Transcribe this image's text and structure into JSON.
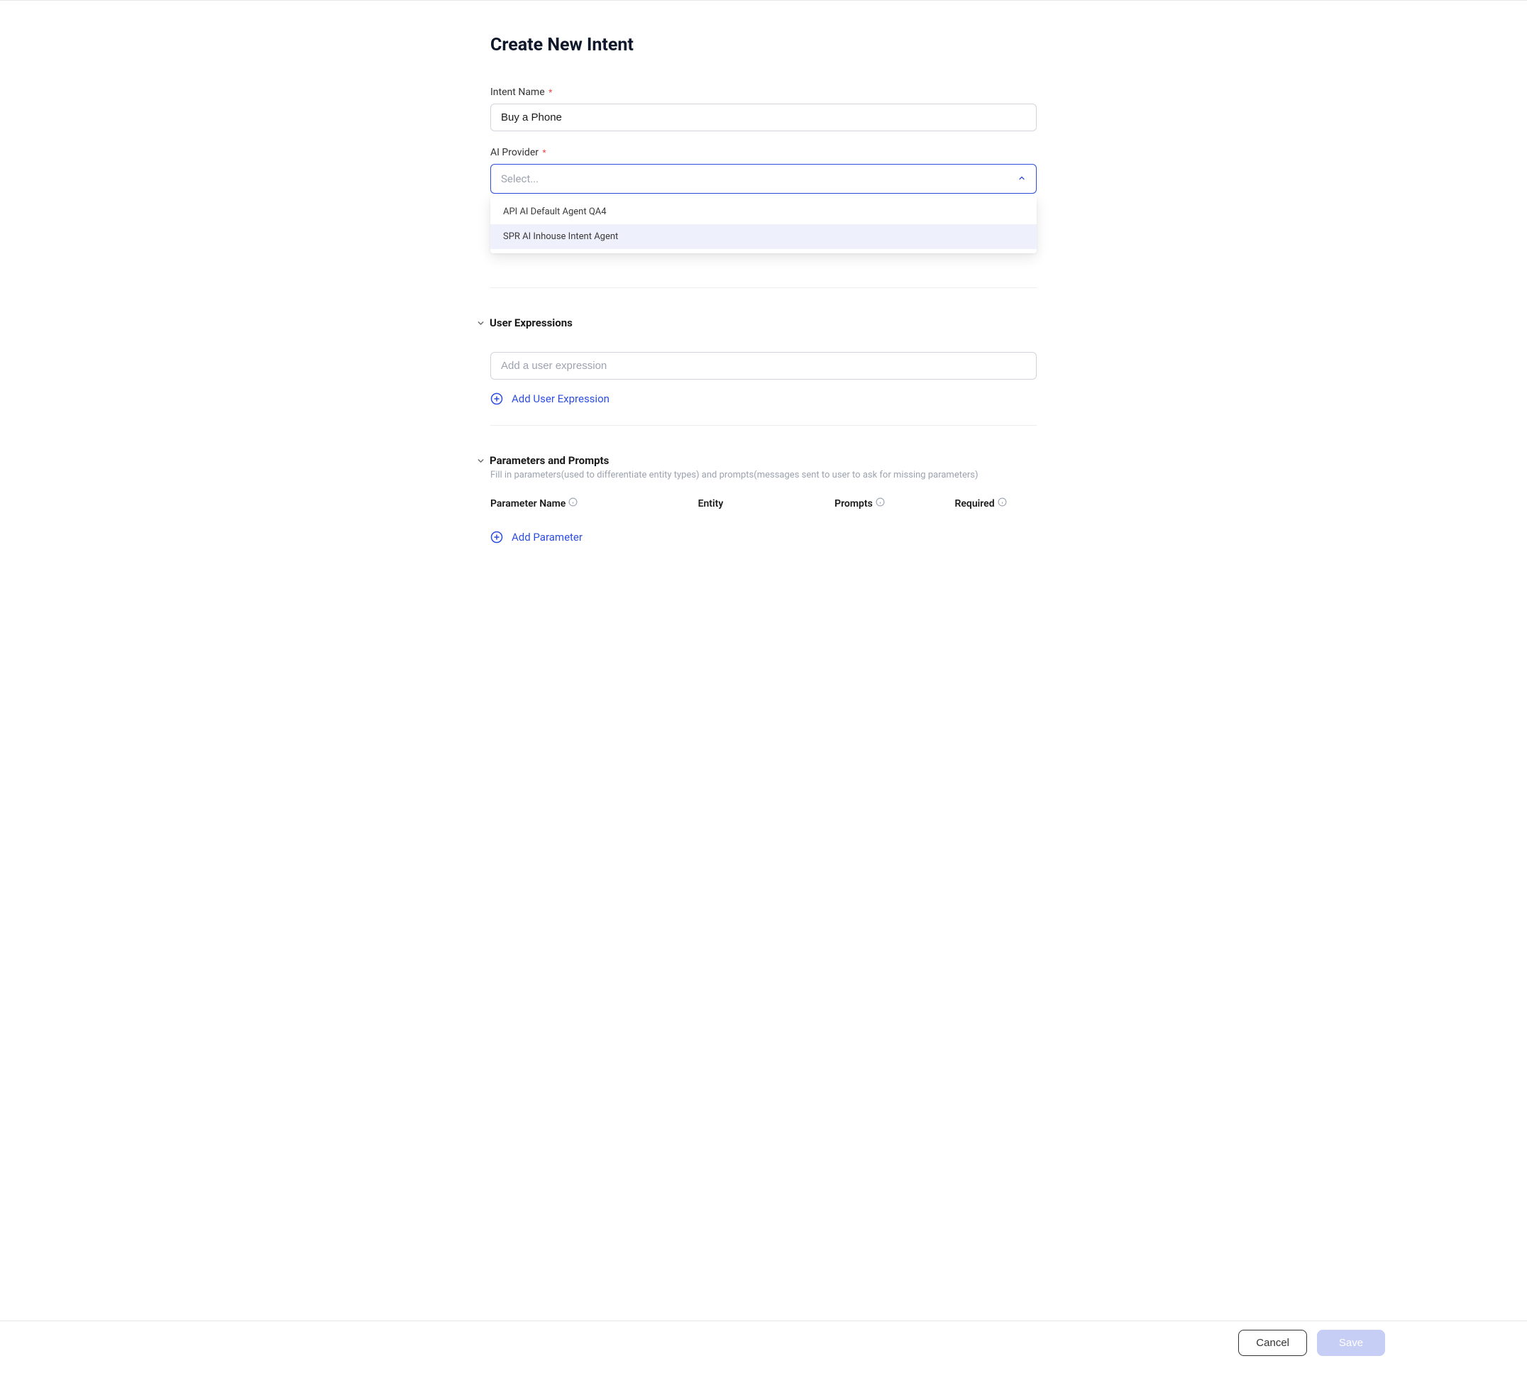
{
  "header": {
    "title": "Create New Intent"
  },
  "form": {
    "intentName": {
      "label": "Intent Name",
      "value": "Buy a Phone"
    },
    "aiProvider": {
      "label": "AI Provider",
      "placeholder": "Select...",
      "options": [
        "API AI Default Agent QA4",
        "SPR AI Inhouse Intent Agent"
      ]
    }
  },
  "sections": {
    "userExpressions": {
      "title": "User Expressions",
      "placeholder": "Add a user expression",
      "addLabel": "Add User Expression"
    },
    "parameters": {
      "title": "Parameters and Prompts",
      "subtext": "Fill in parameters(used to differentiate entity types) and prompts(messages sent to user to ask for missing parameters)",
      "columns": {
        "name": "Parameter Name",
        "entity": "Entity",
        "prompts": "Prompts",
        "required": "Required"
      },
      "addLabel": "Add Parameter"
    }
  },
  "footer": {
    "cancel": "Cancel",
    "save": "Save"
  }
}
